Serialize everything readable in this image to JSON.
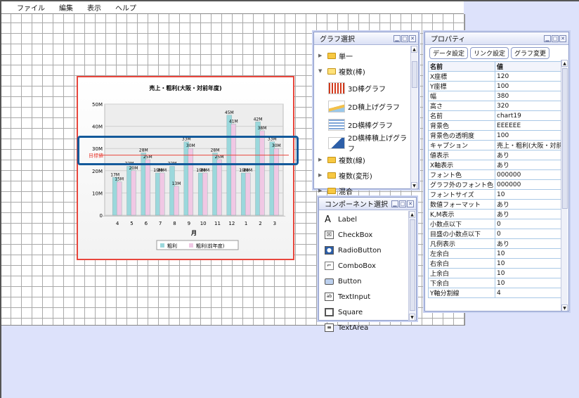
{
  "menu": {
    "items": [
      "ファイル",
      "編集",
      "表示",
      "ヘルプ"
    ]
  },
  "colors": {
    "series1": "#9bd8dc",
    "series2": "#f0c8e4",
    "target_line": "#e8463c",
    "highlight": "#145a9b"
  },
  "chart_data": {
    "type": "bar",
    "title": "売上・粗利(大阪・対前年度)",
    "xlabel": "月",
    "ylabel": "",
    "categories": [
      "4",
      "5",
      "6",
      "7",
      "8",
      "9",
      "10",
      "11",
      "12",
      "1",
      "2",
      "3"
    ],
    "yticks": [
      "50M",
      "40M",
      "30M",
      "20M",
      "10M",
      "0"
    ],
    "ylim": [
      0,
      50
    ],
    "target_label": "目標値",
    "target_value": 27,
    "series": [
      {
        "name": "粗利",
        "values": [
          17,
          22,
          28,
          19,
          22,
          33,
          19,
          28,
          45,
          19,
          42,
          33
        ],
        "labels": [
          "17M",
          "22M",
          "28M",
          "19M",
          "22M",
          "33M",
          "19M",
          "28M",
          "45M",
          "19M",
          "42M",
          "33M"
        ]
      },
      {
        "name": "粗利(前年度)",
        "values": [
          15,
          20,
          25,
          19,
          13,
          30,
          19,
          25,
          41,
          19,
          38,
          30
        ],
        "labels": [
          "15M",
          "20M",
          "25M",
          "19M",
          "13M",
          "30M",
          "19M",
          "25M",
          "41M",
          "19M",
          "38M",
          "30M"
        ]
      }
    ],
    "legend": "bottom"
  },
  "graph_panel": {
    "title": "グラフ選択",
    "items": [
      {
        "label": "単一",
        "expanded": false
      },
      {
        "label": "複数(棒)",
        "expanded": true
      },
      {
        "label": "3D棒グラフ"
      },
      {
        "label": "2D積上げグラフ"
      },
      {
        "label": "2D横棒グラフ"
      },
      {
        "label": "2D横棒積上げグラフ"
      },
      {
        "label": "複数(線)",
        "expanded": false
      },
      {
        "label": "複数(変形)",
        "expanded": false
      },
      {
        "label": "混合",
        "expanded": false
      }
    ]
  },
  "component_panel": {
    "title": "コンポーネント選択",
    "items": [
      {
        "label": "Label",
        "icon": "label-icon"
      },
      {
        "label": "CheckBox",
        "icon": "checkbox-icon"
      },
      {
        "label": "RadioButton",
        "icon": "radio-icon"
      },
      {
        "label": "ComboBox",
        "icon": "combobox-icon"
      },
      {
        "label": "Button",
        "icon": "button-icon"
      },
      {
        "label": "TextInput",
        "icon": "textinput-icon"
      },
      {
        "label": "Square",
        "icon": "square-icon"
      },
      {
        "label": "TextArea",
        "icon": "textarea-icon"
      }
    ]
  },
  "property_panel": {
    "title": "プロパティ",
    "buttons": [
      "データ設定",
      "リンク設定",
      "グラフ変更"
    ],
    "headers": [
      "名前",
      "値"
    ],
    "rows": [
      [
        "X座標",
        "120"
      ],
      [
        "Y座標",
        "100"
      ],
      [
        "幅",
        "380"
      ],
      [
        "高さ",
        "320"
      ],
      [
        "名前",
        "chart19"
      ],
      [
        "背景色",
        "EEEEEE"
      ],
      [
        "背景色の透明度",
        "100"
      ],
      [
        "キャプション",
        "売上・粗利(大阪・対前"
      ],
      [
        "値表示",
        "あり"
      ],
      [
        "X軸表示",
        "あり"
      ],
      [
        "フォント色",
        "000000"
      ],
      [
        "グラフ外のフォント色",
        "000000"
      ],
      [
        "フォントサイズ",
        "10"
      ],
      [
        "数値フォーマット",
        "あり"
      ],
      [
        "K,M表示",
        "あり"
      ],
      [
        "小数点以下",
        "0"
      ],
      [
        "目盛の小数点以下",
        "0"
      ],
      [
        "凡例表示",
        "あり"
      ],
      [
        "左余白",
        "10"
      ],
      [
        "右余白",
        "10"
      ],
      [
        "上余白",
        "10"
      ],
      [
        "下余白",
        "10"
      ],
      [
        "Y軸分割線",
        "4"
      ]
    ]
  }
}
